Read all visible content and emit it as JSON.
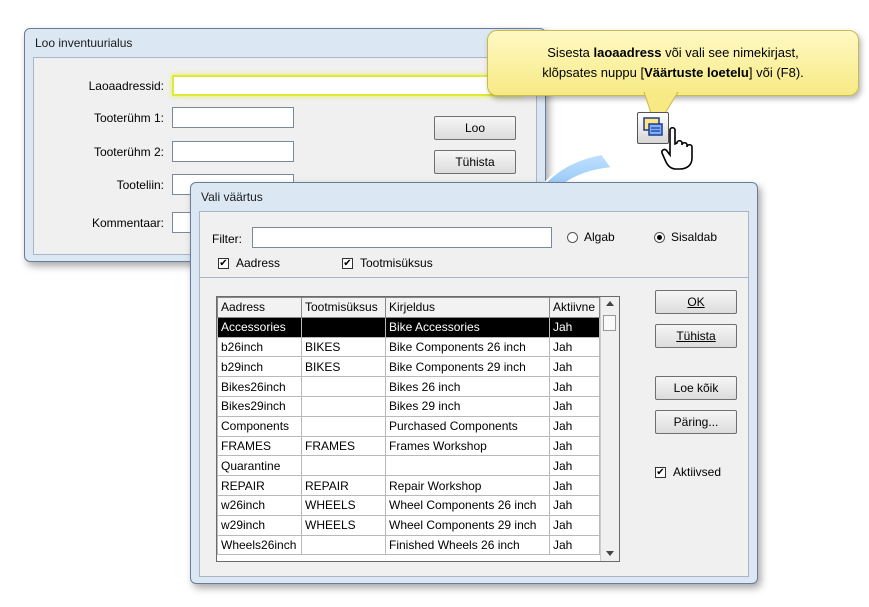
{
  "window1": {
    "title": "Loo inventuurialus",
    "fields": [
      {
        "label": "Laoaadressid:",
        "value": ""
      },
      {
        "label": "Tooterühm 1:",
        "value": ""
      },
      {
        "label": "Tooterühm 2:",
        "value": ""
      },
      {
        "label": "Tooteliin:",
        "value": ""
      },
      {
        "label": "Kommentaar:",
        "value": ""
      }
    ],
    "create_label": "Loo",
    "cancel_label": "Tühista"
  },
  "callout": {
    "p1": "Sisesta ",
    "b1": "laoaadress",
    "p2": " või vali see nimekirjast,",
    "p3": "klõpsates nuppu [",
    "b2": "Väärtuste loetelu",
    "p4": "] või (F8)."
  },
  "window2": {
    "title": "Vali väärtus",
    "filter_label": "Filter:",
    "filter_value": "",
    "radio_starts": "Algab",
    "radio_contains": "Sisaldab",
    "check_address": "Aadress",
    "check_unit": "Tootmisüksus",
    "columns": [
      "Aadress",
      "Tootmisüksus",
      "Kirjeldus",
      "Aktiivne"
    ],
    "rows": [
      [
        "Accessories",
        "",
        "Bike Accessories",
        "Jah"
      ],
      [
        "b26inch",
        "BIKES",
        "Bike Components 26 inch",
        "Jah"
      ],
      [
        "b29inch",
        "BIKES",
        "Bike Components 29 inch",
        "Jah"
      ],
      [
        "Bikes26inch",
        "",
        "Bikes 26 inch",
        "Jah"
      ],
      [
        "Bikes29inch",
        "",
        "Bikes 29 inch",
        "Jah"
      ],
      [
        "Components",
        "",
        "Purchased Components",
        "Jah"
      ],
      [
        "FRAMES",
        "FRAMES",
        "Frames Workshop",
        "Jah"
      ],
      [
        "Quarantine",
        "",
        "",
        "Jah"
      ],
      [
        "REPAIR",
        "REPAIR",
        "Repair Workshop",
        "Jah"
      ],
      [
        "w26inch",
        "WHEELS",
        "Wheel Components 26 inch",
        "Jah"
      ],
      [
        "w29inch",
        "WHEELS",
        "Wheel Components 29 inch",
        "Jah"
      ],
      [
        "Wheels26inch",
        "",
        "Finished Wheels 26 inch",
        "Jah"
      ]
    ],
    "ok_label": "OK",
    "cancel_label": "Tühista",
    "load_all_label": "Loe kõik",
    "query_label": "Päring...",
    "active_label": "Aktiivsed"
  },
  "colors": {
    "accent_arrow": "#2f8fe0",
    "callout_bg": "#f9ef9a",
    "highlight": "#e6f04a"
  }
}
